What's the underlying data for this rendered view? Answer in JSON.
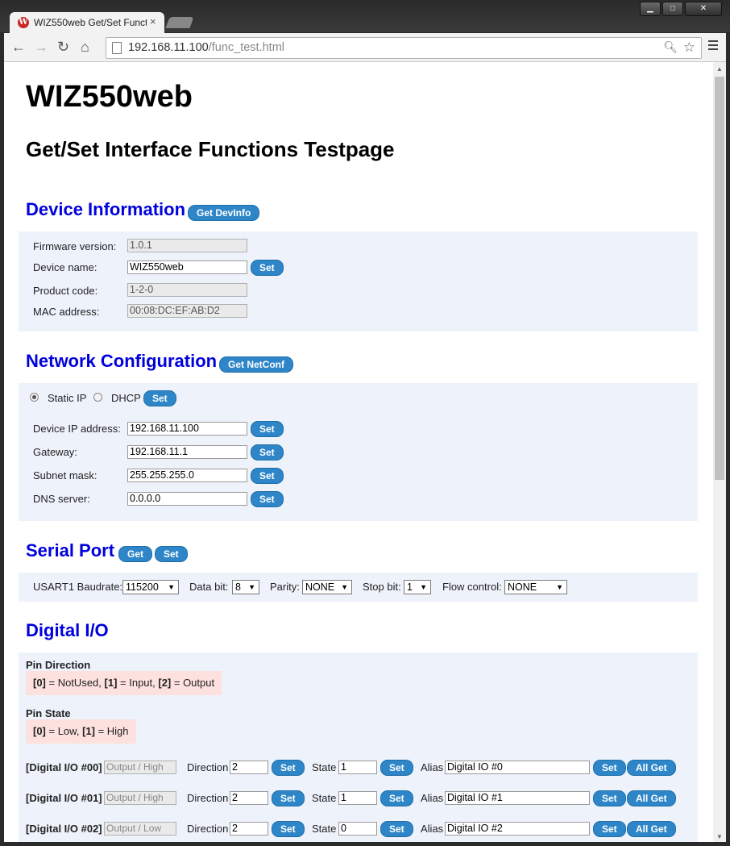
{
  "browser": {
    "tab_title": "WIZ550web Get/Set Funct",
    "tab_close": "×",
    "favicon_letter": "W",
    "url_host": "192.168.11.100",
    "url_path": "/func_test.html",
    "win_minimize": "▁",
    "win_maximize": "□",
    "win_close": "✕"
  },
  "page": {
    "title": "WIZ550web",
    "subtitle": "Get/Set Interface Functions Testpage"
  },
  "device_info": {
    "heading": "Device Information",
    "get_button": "Get DevInfo",
    "firmware_label": "Firmware version:",
    "firmware_value": "1.0.1",
    "name_label": "Device name:",
    "name_value": "WIZ550web",
    "name_set": "Set",
    "product_label": "Product code:",
    "product_value": "1-2-0",
    "mac_label": "MAC address:",
    "mac_value": "00:08:DC:EF:AB:D2"
  },
  "network": {
    "heading": "Network Configuration",
    "get_button": "Get NetConf",
    "static_label": "Static IP",
    "dhcp_label": "DHCP",
    "mode_set": "Set",
    "ip_label": "Device IP address:",
    "ip_value": "192.168.11.100",
    "gw_label": "Gateway:",
    "gw_value": "192.168.11.1",
    "mask_label": "Subnet mask:",
    "mask_value": "255.255.255.0",
    "dns_label": "DNS server:",
    "dns_value": "0.0.0.0",
    "set": "Set"
  },
  "serial": {
    "heading": "Serial Port",
    "get_button": "Get",
    "set_button": "Set",
    "baud_label": "USART1 Baudrate:",
    "baud_value": "115200",
    "databit_label": "Data bit:",
    "databit_value": "8",
    "parity_label": "Parity:",
    "parity_value": "NONE",
    "stopbit_label": "Stop bit:",
    "stopbit_value": "1",
    "flow_label": "Flow control:",
    "flow_value": "NONE"
  },
  "dio": {
    "heading": "Digital I/O",
    "pin_dir_title": "Pin Direction",
    "pin_dir_note": {
      "k0": "[0]",
      "t0": " = NotUsed, ",
      "k1": "[1]",
      "t1": " = Input, ",
      "k2": "[2]",
      "t2": " = Output"
    },
    "pin_state_title": "Pin State",
    "pin_state_note": {
      "k0": "[0]",
      "t0": " = Low, ",
      "k1": "[1]",
      "t1": " = High"
    },
    "direction_label": "Direction",
    "state_label": "State",
    "alias_label": "Alias",
    "set": "Set",
    "all_get": "All Get",
    "rows": [
      {
        "name": "[Digital I/O #00]",
        "status": "Output / High",
        "direction": "2",
        "state": "1",
        "alias": "Digital IO #0"
      },
      {
        "name": "[Digital I/O #01]",
        "status": "Output / High",
        "direction": "2",
        "state": "1",
        "alias": "Digital IO #1"
      },
      {
        "name": "[Digital I/O #02]",
        "status": "Output / Low",
        "direction": "2",
        "state": "0",
        "alias": "Digital IO #2"
      }
    ]
  }
}
